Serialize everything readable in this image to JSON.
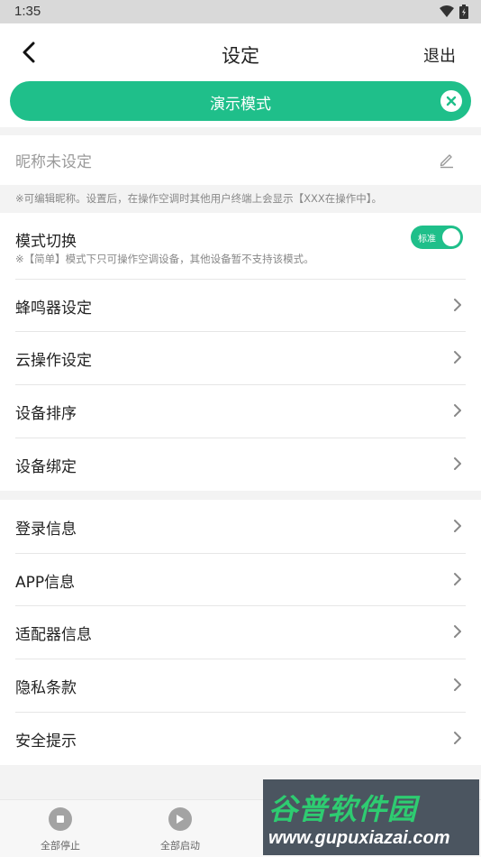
{
  "status_bar": {
    "time": "1:35"
  },
  "header": {
    "title": "设定",
    "logout_label": "退出"
  },
  "demo_banner": {
    "label": "演示模式"
  },
  "nickname": {
    "placeholder_text": "昵称未设定",
    "note": "※可编辑昵称。设置后，在操作空调时其他用户终端上会显示【XXX在操作中】。"
  },
  "mode_switch": {
    "label": "模式切换",
    "note": "※【简单】模式下只可操作空调设备，其他设备暂不支持该模式。",
    "toggle_label": "标准"
  },
  "section1_items": [
    "蜂鸣器设定",
    "云操作设定",
    "设备排序",
    "设备绑定"
  ],
  "section2_items": [
    "登录信息",
    "APP信息",
    "适配器信息",
    "隐私条款",
    "安全提示"
  ],
  "bottom_tabs": [
    {
      "label": "全部停止",
      "icon": "stop-icon"
    },
    {
      "label": "全部启动",
      "icon": "play-icon"
    }
  ],
  "watermark": {
    "brand": "谷普软件园",
    "url": "www.gupuxiazai.com"
  },
  "colors": {
    "accent": "#1fbf8a",
    "background": "#f3f3f3"
  }
}
